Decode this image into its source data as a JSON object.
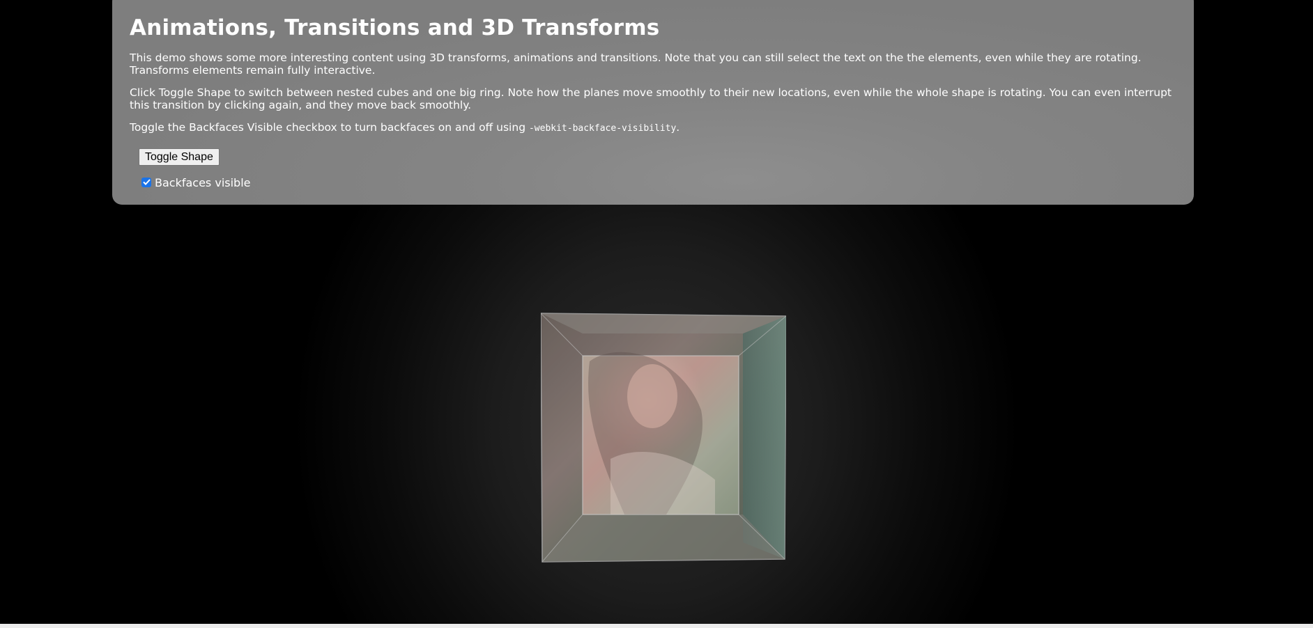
{
  "panel": {
    "title": "Animations, Transitions and 3D Transforms",
    "paragraph1": "This demo shows some more interesting content using 3D transforms, animations and transitions. Note that you can still select the text on the the elements, even while they are rotating. Transforms elements remain fully interactive.",
    "paragraph2": "Click Toggle Shape to switch between nested cubes and one big ring. Note how the planes move smoothly to their new locations, even while the whole shape is rotating. You can even interrupt this transition by clicking again, and they move back smoothly.",
    "paragraph3_prefix": "Toggle the Backfaces Visible checkbox to turn backfaces on and off using ",
    "paragraph3_code": "-webkit-backface-visibility",
    "paragraph3_suffix": "."
  },
  "controls": {
    "toggle_shape_label": "Toggle Shape",
    "backfaces_label": "Backfaces visible",
    "backfaces_checked": true
  },
  "colors": {
    "panel_bg": "#858585",
    "checkbox_accent": "#1a73e8",
    "page_bg": "#000000"
  },
  "icons": {
    "checkbox": "checkmark-icon"
  }
}
